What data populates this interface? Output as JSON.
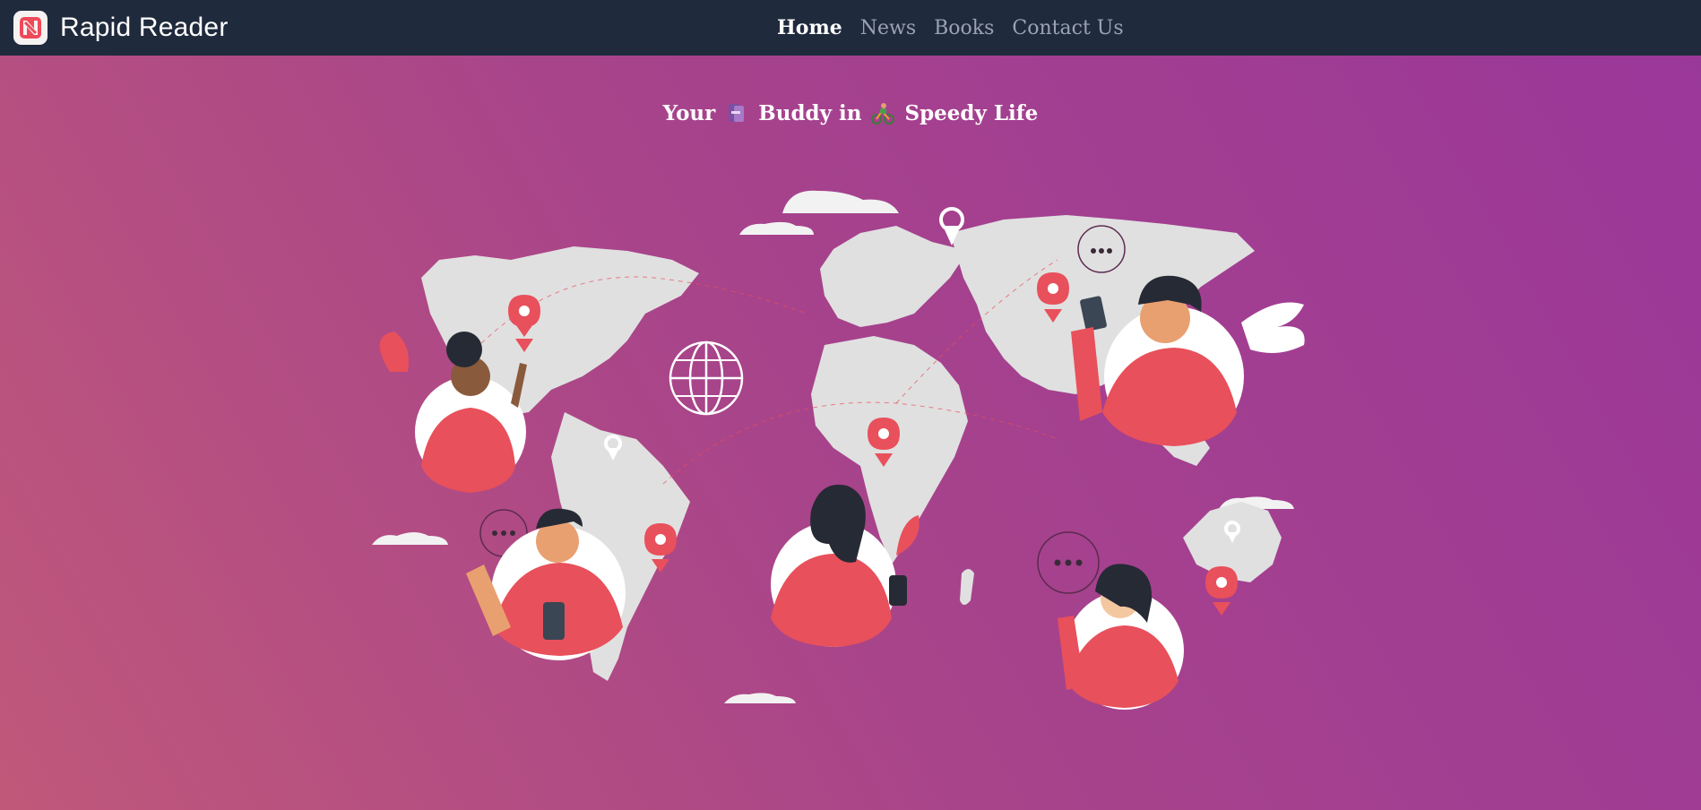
{
  "app": {
    "name": "Rapid Reader"
  },
  "nav": {
    "items": [
      {
        "label": "Home",
        "active": true
      },
      {
        "label": "News",
        "active": false
      },
      {
        "label": "Books",
        "active": false
      },
      {
        "label": "Contact Us",
        "active": false
      }
    ]
  },
  "hero": {
    "title_part1": "Your",
    "title_part2": "Buddy in",
    "title_part3": "Speedy Life",
    "emoji1": "books-emoji",
    "emoji2": "cyclist-emoji"
  },
  "illustration": {
    "name": "world-map-people-illustration"
  },
  "colors": {
    "navbar": "#1f2a3c",
    "accent": "#e8505b",
    "map": "#e0e0e0"
  }
}
